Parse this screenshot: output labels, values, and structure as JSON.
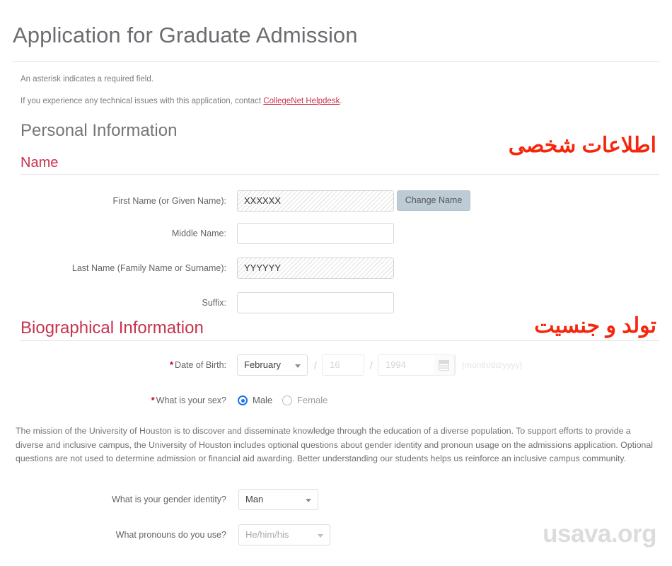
{
  "header": {
    "title": "Application for Graduate Admission"
  },
  "notes": {
    "asterisk": "An asterisk indicates a required field.",
    "helpdesk_prefix": "If you experience any technical issues with this application, contact ",
    "helpdesk_link": "CollegeNet Helpdesk",
    "helpdesk_suffix": "."
  },
  "sections": {
    "personal_information": "Personal Information",
    "name": "Name",
    "biographical_information": "Biographical Information"
  },
  "name_fields": {
    "first_name": {
      "label": "First Name (or Given Name):",
      "value": "XXXXXX",
      "disabled": true
    },
    "middle_name": {
      "label": "Middle Name:",
      "value": ""
    },
    "last_name": {
      "label": "Last Name (Family Name or Surname):",
      "value": "YYYYYY",
      "disabled": true
    },
    "suffix": {
      "label": "Suffix:",
      "value": ""
    },
    "change_name_button": "Change Name"
  },
  "biographical": {
    "dob": {
      "label": "Date of Birth:",
      "month": "February",
      "day": "16",
      "year": "1994",
      "hint": "(month/dd/yyyy)",
      "calendar_icon": "calendar-icon",
      "separator": "/"
    },
    "sex": {
      "label": "What is your sex?",
      "options": [
        {
          "label": "Male",
          "selected": true
        },
        {
          "label": "Female",
          "selected": false
        }
      ]
    },
    "mission_paragraph": "The mission of the University of Houston is to discover and disseminate knowledge through the education of a diverse population. To support efforts to provide a diverse and inclusive campus, the University of Houston includes optional questions about gender identity and pronoun usage on the admissions application. Optional questions are not used to determine admission or financial aid awarding. Better understanding our students helps us reinforce an inclusive campus community.",
    "gender_identity": {
      "label": "What is your gender identity?",
      "value": "Man"
    },
    "pronouns": {
      "label": "What pronouns do you use?",
      "value": "He/him/his"
    }
  },
  "annotations": {
    "personal_information_fa": "اطلاعات شخصی",
    "birth_and_gender_fa": "تولد و جنسیت"
  },
  "watermark": {
    "text": "usava.org"
  },
  "colors": {
    "accent_red": "#c8334e",
    "annotation_red": "#f4270d",
    "radio_blue": "#1a73e8",
    "button_blue_grey": "#bccbd4",
    "heading_grey": "#6b6d70"
  }
}
